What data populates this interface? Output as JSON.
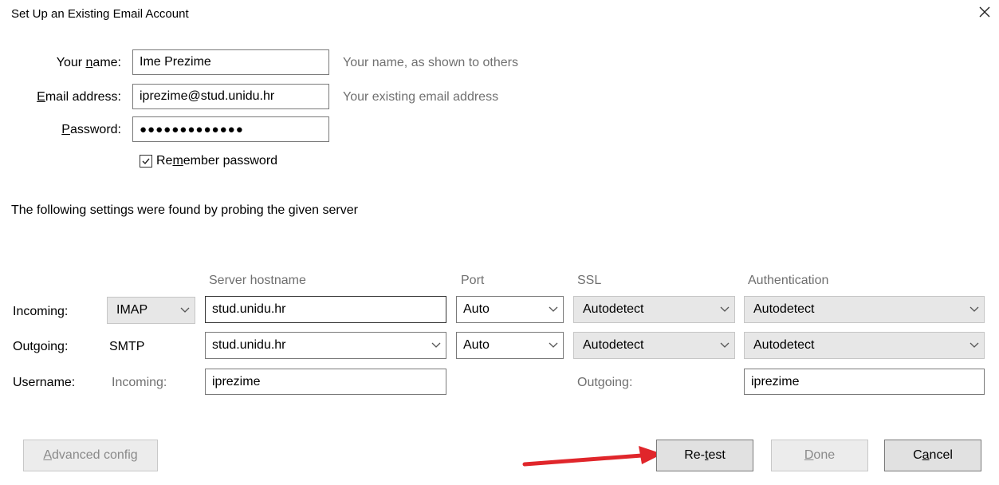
{
  "window": {
    "title": "Set Up an Existing Email Account",
    "close_icon": "close-icon"
  },
  "identity": {
    "name_label_pre": "Your ",
    "name_label_key": "n",
    "name_label_post": "ame:",
    "name_value": "Ime Prezime",
    "name_hint": "Your name, as shown to others",
    "email_label_key": "E",
    "email_label_post": "mail address:",
    "email_value": "iprezime@stud.unidu.hr",
    "email_hint": "Your existing email address",
    "password_label_key": "P",
    "password_label_post": "assword:",
    "password_value": "●●●●●●●●●●●●●",
    "remember_pre": "Re",
    "remember_key": "m",
    "remember_post": "ember password",
    "remember_checked": true
  },
  "probe_message": "The following settings were found by probing the given server",
  "server": {
    "headers": {
      "hostname": "Server hostname",
      "port": "Port",
      "ssl": "SSL",
      "auth": "Authentication"
    },
    "incoming": {
      "label": "Incoming:",
      "protocol": "IMAP",
      "hostname": "stud.unidu.hr",
      "port": "Auto",
      "ssl": "Autodetect",
      "auth": "Autodetect"
    },
    "outgoing": {
      "label": "Outgoing:",
      "protocol": "SMTP",
      "hostname": "stud.unidu.hr",
      "port": "Auto",
      "ssl": "Autodetect",
      "auth": "Autodetect"
    },
    "username": {
      "label": "Username:",
      "incoming_label": "Incoming:",
      "incoming_value": "iprezime",
      "outgoing_label": "Outgoing:",
      "outgoing_value": "iprezime"
    }
  },
  "buttons": {
    "advanced_key": "A",
    "advanced_post": "dvanced config",
    "retest_pre": "Re-",
    "retest_key": "t",
    "retest_post": "est",
    "done_key": "D",
    "done_post": "one",
    "cancel_pre": "C",
    "cancel_key": "a",
    "cancel_post": "ncel"
  },
  "colors": {
    "annotation_arrow": "#e0262b",
    "hint_text": "#707070",
    "focus_border": "#2f79d6"
  }
}
